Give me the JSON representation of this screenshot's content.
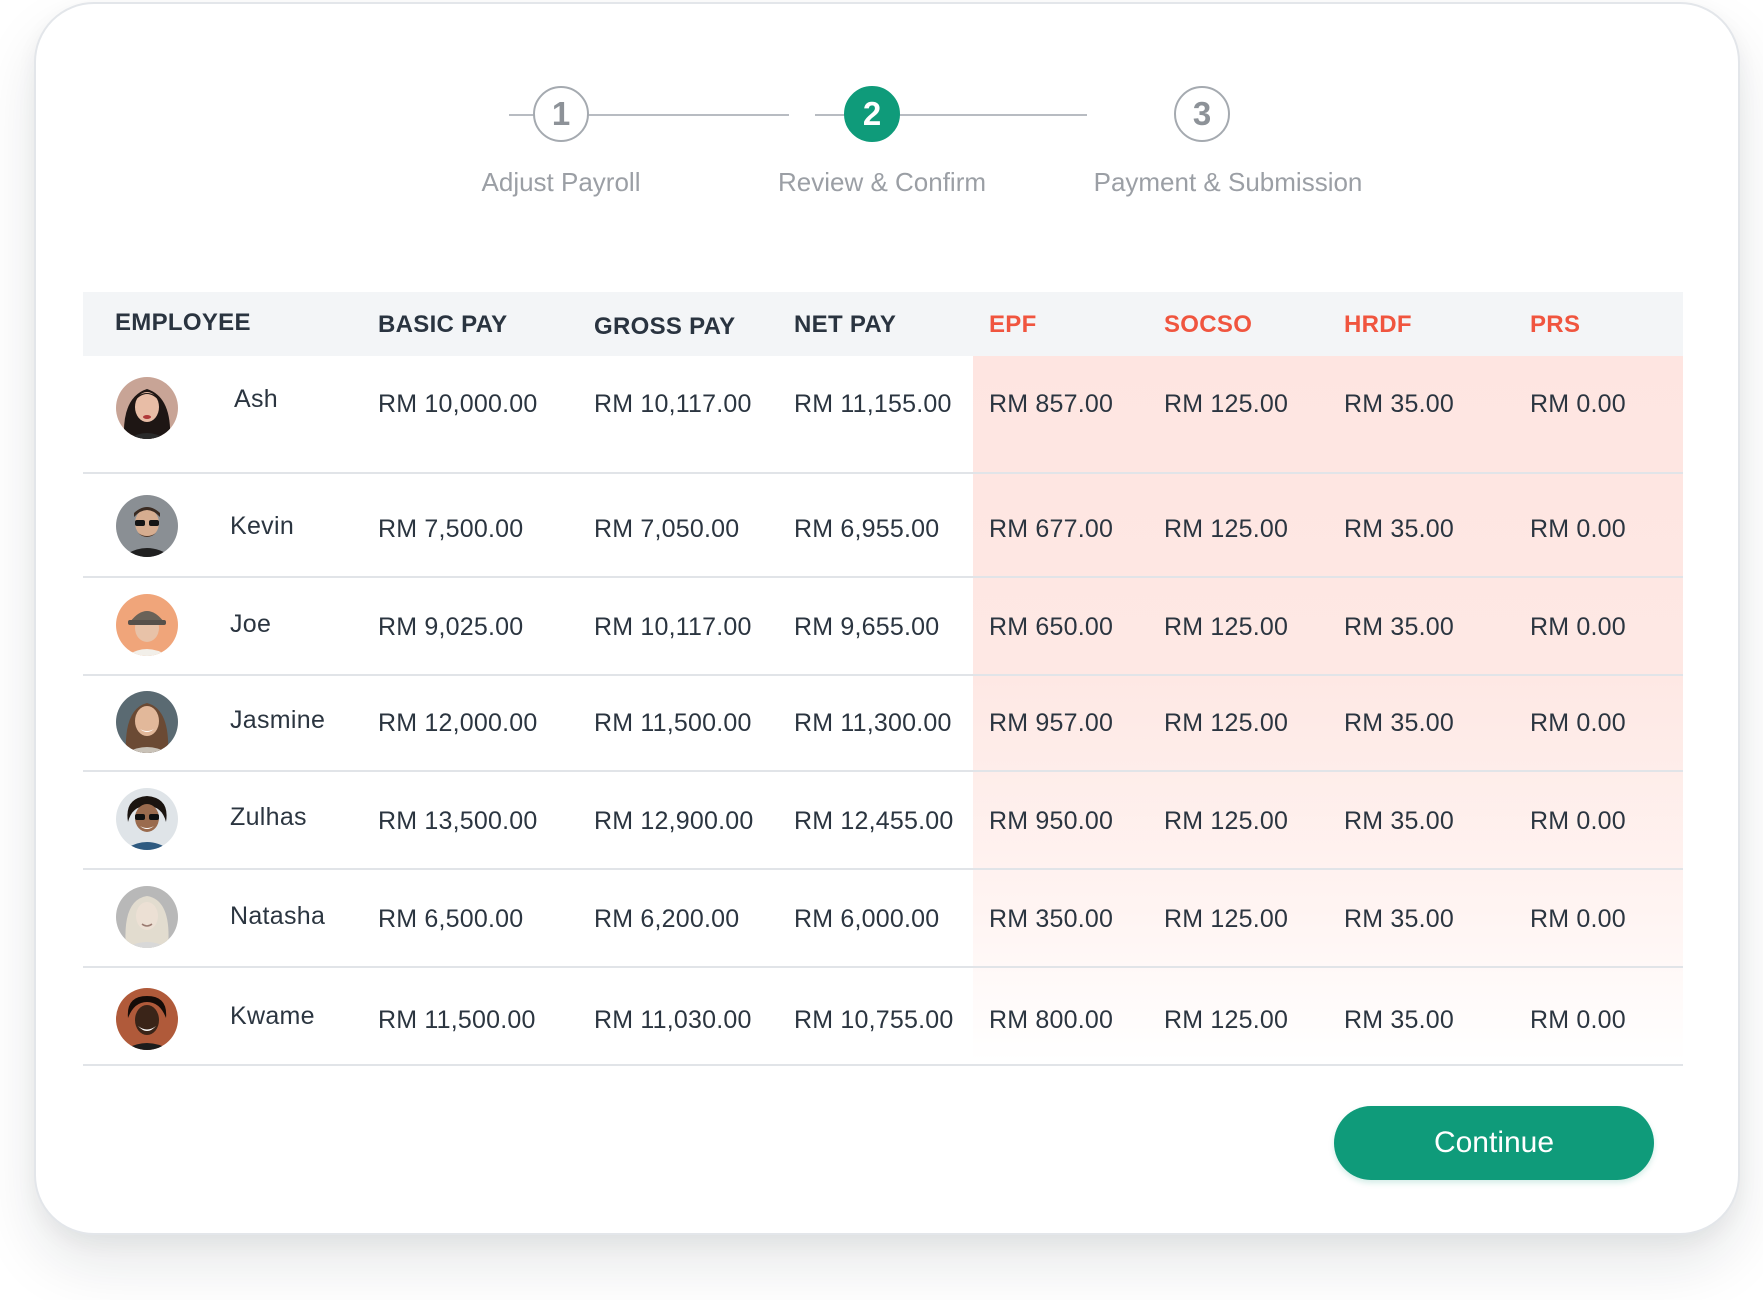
{
  "stepper": {
    "steps": [
      {
        "number": "1",
        "label": "Adjust Payroll",
        "state": "inactive"
      },
      {
        "number": "2",
        "label": "Review & Confirm",
        "state": "active"
      },
      {
        "number": "3",
        "label": "Payment & Submission",
        "state": "inactive"
      }
    ]
  },
  "table": {
    "headers": {
      "employee": "EMPLOYEE",
      "basic_pay": "BASIC PAY",
      "gross_pay": "GROSS PAY",
      "net_pay": "NET PAY",
      "epf": "EPF",
      "socso": "SOCSO",
      "hrdf": "HRDF",
      "prs": "PRS"
    },
    "rows": [
      {
        "name": "Ash",
        "basic_pay": "RM 10,000.00",
        "gross_pay": "RM 10,117.00",
        "net_pay": "RM 11,155.00",
        "epf": "RM 857.00",
        "socso": "RM 125.00",
        "hrdf": "RM 35.00",
        "prs": "RM 0.00"
      },
      {
        "name": "Kevin",
        "basic_pay": "RM 7,500.00",
        "gross_pay": "RM 7,050.00",
        "net_pay": "RM 6,955.00",
        "epf": "RM 677.00",
        "socso": "RM 125.00",
        "hrdf": "RM 35.00",
        "prs": "RM 0.00"
      },
      {
        "name": "Joe",
        "basic_pay": "RM 9,025.00",
        "gross_pay": "RM 10,117.00",
        "net_pay": "RM 9,655.00",
        "epf": "RM 650.00",
        "socso": "RM 125.00",
        "hrdf": "RM 35.00",
        "prs": "RM 0.00"
      },
      {
        "name": "Jasmine",
        "basic_pay": "RM 12,000.00",
        "gross_pay": "RM 11,500.00",
        "net_pay": "RM 11,300.00",
        "epf": "RM 957.00",
        "socso": "RM 125.00",
        "hrdf": "RM 35.00",
        "prs": "RM 0.00"
      },
      {
        "name": "Zulhas",
        "basic_pay": "RM 13,500.00",
        "gross_pay": "RM 12,900.00",
        "net_pay": "RM 12,455.00",
        "epf": "RM 950.00",
        "socso": "RM 125.00",
        "hrdf": "RM 35.00",
        "prs": "RM 0.00"
      },
      {
        "name": "Natasha",
        "basic_pay": "RM 6,500.00",
        "gross_pay": "RM 6,200.00",
        "net_pay": "RM 6,000.00",
        "epf": "RM 350.00",
        "socso": "RM 125.00",
        "hrdf": "RM 35.00",
        "prs": "RM 0.00"
      },
      {
        "name": "Kwame",
        "basic_pay": "RM 11,500.00",
        "gross_pay": "RM 11,030.00",
        "net_pay": "RM 10,755.00",
        "epf": "RM 800.00",
        "socso": "RM 125.00",
        "hrdf": "RM 35.00",
        "prs": "RM 0.00"
      }
    ]
  },
  "actions": {
    "continue_label": "Continue"
  },
  "colors": {
    "accent": "#0f9b7a",
    "deduction_header": "#f0553f",
    "deduction_bg": "#fee5e1"
  }
}
